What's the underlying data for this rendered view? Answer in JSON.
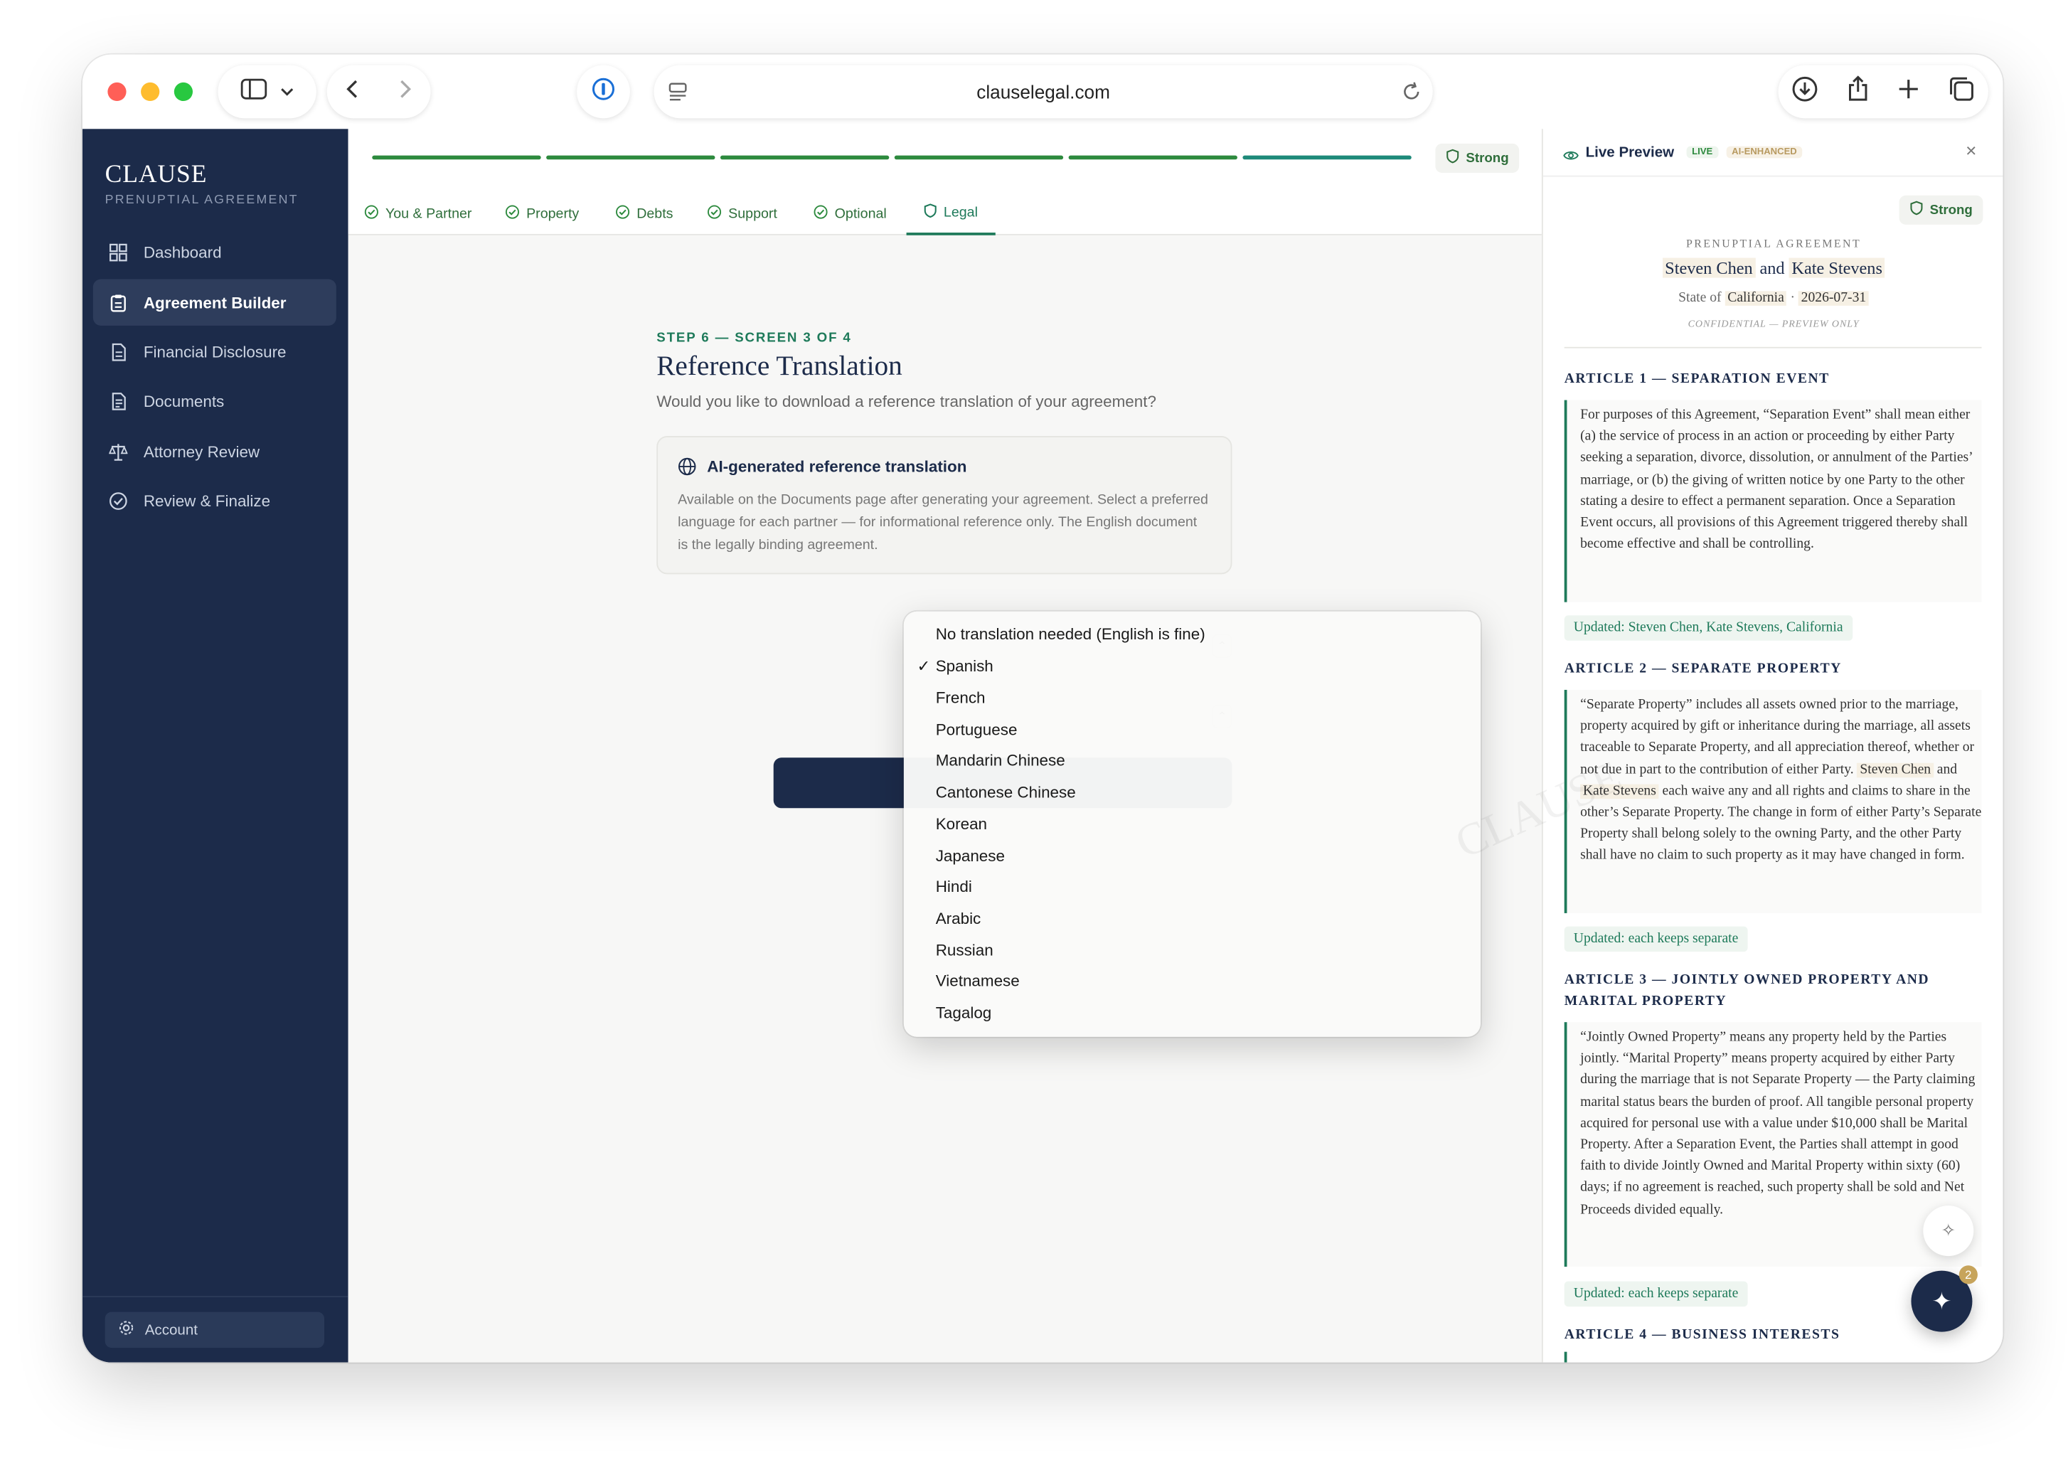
{
  "browser": {
    "url": "clauselegal.com"
  },
  "sidebar": {
    "brand": "CLAUSE",
    "brand_sub": "PRENUPTIAL AGREEMENT",
    "items": [
      {
        "label": "Dashboard",
        "icon": "grid-icon"
      },
      {
        "label": "Agreement Builder",
        "icon": "clipboard-icon",
        "active": true
      },
      {
        "label": "Financial Disclosure",
        "icon": "document-icon"
      },
      {
        "label": "Documents",
        "icon": "file-icon"
      },
      {
        "label": "Attorney Review",
        "icon": "scale-icon"
      },
      {
        "label": "Review & Finalize",
        "icon": "check-circle-icon"
      }
    ],
    "account": "Account"
  },
  "main": {
    "progress_strength": "Strong",
    "tabs": [
      {
        "label": "You & Partner"
      },
      {
        "label": "Property"
      },
      {
        "label": "Debts"
      },
      {
        "label": "Support"
      },
      {
        "label": "Optional"
      },
      {
        "label": "Legal",
        "active": true
      }
    ],
    "step_label": "STEP 6 — SCREEN 3 OF 4",
    "title": "Reference Translation",
    "subtitle": "Would you like to download a reference translation of your agreement?",
    "info_card": {
      "title": "AI-generated reference translation",
      "body": "Available on the Documents page after generating your agreement. Select a preferred language for each partner — for informational reference only. The English document is the legally binding agreement."
    },
    "dropdown": {
      "selected": "Spanish",
      "options": [
        "No translation needed (English is fine)",
        "Spanish",
        "French",
        "Portuguese",
        "Mandarin Chinese",
        "Cantonese Chinese",
        "Korean",
        "Japanese",
        "Hindi",
        "Arabic",
        "Russian",
        "Vietnamese",
        "Tagalog"
      ]
    }
  },
  "preview": {
    "title": "Live Preview",
    "live_badge": "LIVE",
    "ai_badge": "AI-ENHANCED",
    "strength": "Strong",
    "kicker": "PRENUPTIAL AGREEMENT",
    "party1": "Steven Chen",
    "and": "and",
    "party2": "Kate Stevens",
    "state_prefix": "State of",
    "state": "California",
    "date": "2026-07-31",
    "confidential": "CONFIDENTIAL — PREVIEW ONLY",
    "articles": [
      {
        "heading": "ARTICLE 1 — SEPARATION EVENT",
        "body": "For purposes of this Agreement, “Separation Event” shall mean either (a) the service of process in an action or proceeding by either Party seeking a separation, divorce, dissolution, or annulment of the Parties’ marriage, or (b) the giving of written notice by one Party to the other stating a desire to effect a permanent separation. Once a Separation Event occurs, all provisions of this Agreement triggered thereby shall become effective and shall be controlling.",
        "updated": "Updated: Steven Chen, Kate Stevens, California"
      },
      {
        "heading": "ARTICLE 2 — SEPARATE PROPERTY",
        "body_a": "“Separate Property” includes all assets owned prior to the marriage, property acquired by gift or inheritance during the marriage, all assets traceable to Separate Property, and all appreciation thereof, whether or not due in part to the contribution of either Party.",
        "body_b": "each waive any and all rights and claims to share in the other’s Separate Property. The change in form of either Party’s Separate Property shall belong solely to the owning Party, and the other Party shall have no claim to such property as it may have changed in form.",
        "updated": "Updated: each keeps separate"
      },
      {
        "heading": "ARTICLE 3 — JOINTLY OWNED PROPERTY AND MARITAL PROPERTY",
        "body": "“Jointly Owned Property” means any property held by the Parties jointly. “Marital Property” means property acquired by either Party during the marriage that is not Separate Property — the Party claiming marital status bears the burden of proof. All tangible personal property acquired for personal use with a value under $10,000 shall be Marital Property. After a Separation Event, the Parties shall attempt in good faith to divide Jointly Owned and Marital Property within sixty (60) days; if no agreement is reached, such property shall be sold and Net Proceeds divided equally.",
        "updated": "Updated: each keeps separate"
      },
      {
        "heading": "ARTICLE 4 — BUSINESS INTERESTS"
      }
    ],
    "watermark": "CLAUSE",
    "assistant_badge": "2"
  },
  "colors": {
    "navy": "#1c2b4a",
    "green": "#2d8a3e",
    "teal": "#1e7a5a"
  }
}
